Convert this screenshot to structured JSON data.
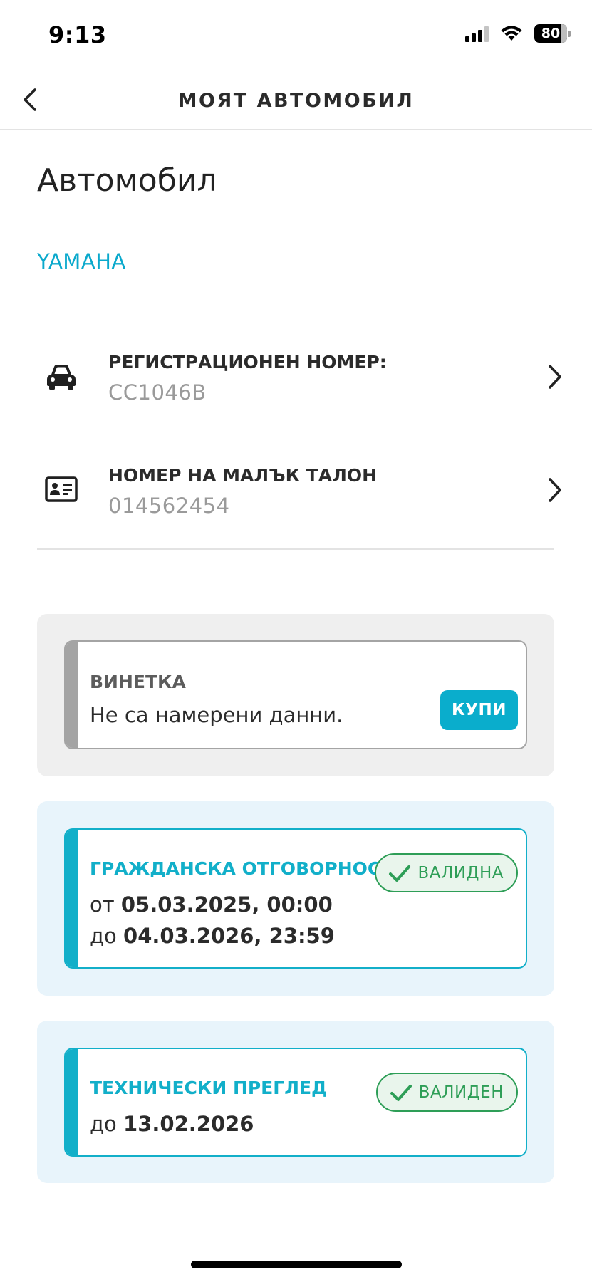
{
  "status_bar": {
    "time": "9:13",
    "battery": "80"
  },
  "nav": {
    "title": "МОЯТ АВТОМОБИЛ",
    "back_icon": "chevron-left-icon"
  },
  "page": {
    "title": "Автомобил",
    "brand": "YAMAHA"
  },
  "vehicle_rows": [
    {
      "label": "РЕГИСТРАЦИОНЕН НОМЕР:",
      "value": "CC1046B",
      "icon": "car-icon"
    },
    {
      "label": "НОМЕР НА МАЛЪК ТАЛОН",
      "value": "014562454",
      "icon": "id-card-icon"
    }
  ],
  "vignette": {
    "title": "ВИНЕТКА",
    "message": "Не са намерени данни.",
    "buy_label": "КУПИ"
  },
  "civil_liability": {
    "title": "ГРАЖДАНСКА ОТГОВОРНОСТ",
    "from_prefix": "от",
    "from_value": "05.03.2025, 00:00",
    "to_prefix": "до",
    "to_value": "04.03.2026, 23:59",
    "badge": "ВАЛИДНА"
  },
  "inspection": {
    "title": "ТЕХНИЧЕСКИ ПРЕГЛЕД",
    "to_prefix": "до",
    "to_value": "13.02.2026",
    "badge": "ВАЛИДЕН"
  },
  "colors": {
    "accent": "#0aadcc",
    "valid_green": "#2e9e57",
    "card_border_gray": "#a4a4a4",
    "panel_gray": "#efefef",
    "panel_blue": "#e8f4fb"
  }
}
